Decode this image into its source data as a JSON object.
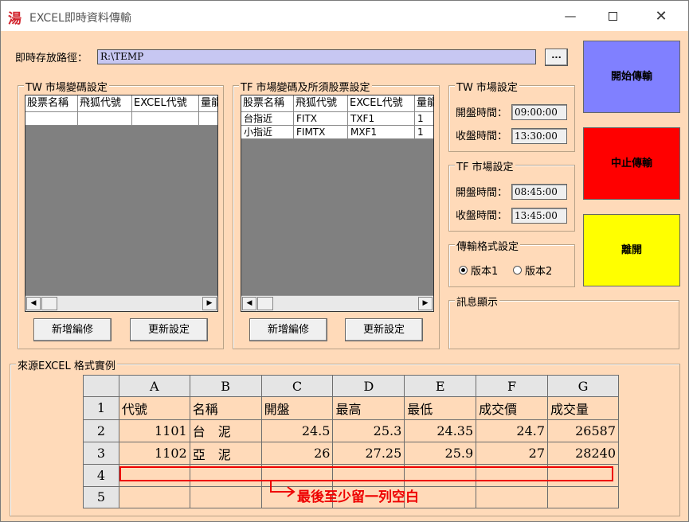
{
  "window": {
    "title": "EXCEL即時資料傳輸",
    "icon_glyph": "湯"
  },
  "path": {
    "label": "即時存放路徑：",
    "value": "R:\\TEMP",
    "browse_label": "..."
  },
  "tw_grid": {
    "legend": "TW 市場變碼設定",
    "headers": [
      "股票名稱",
      "飛狐代號",
      "EXCEL代號",
      "量能"
    ],
    "rows": [
      [
        "",
        "",
        "",
        ""
      ]
    ],
    "add_label": "新增編修",
    "update_label": "更新設定"
  },
  "tf_grid": {
    "legend": "TF 市場變碼及所須股票設定",
    "headers": [
      "股票名稱",
      "飛狐代號",
      "EXCEL代號",
      "量能"
    ],
    "rows": [
      [
        "台指近",
        "FITX",
        "TXF1",
        "1"
      ],
      [
        "小指近",
        "FIMTX",
        "MXF1",
        "1"
      ]
    ],
    "add_label": "新增編修",
    "update_label": "更新設定"
  },
  "tw_market": {
    "legend": "TW 市場設定",
    "open_label": "開盤時間：",
    "open_value": "09:00:00",
    "close_label": "收盤時間：",
    "close_value": "13:30:00"
  },
  "tf_market": {
    "legend": "TF 市場設定",
    "open_label": "開盤時間：",
    "open_value": "08:45:00",
    "close_label": "收盤時間：",
    "close_value": "13:45:00"
  },
  "format": {
    "legend": "傳輸格式設定",
    "option1": "版本1",
    "option2": "版本2",
    "selected": "版本1"
  },
  "message": {
    "legend": "訊息顯示"
  },
  "actions": {
    "start_label": "開始傳輸",
    "start_color": "#8080ff",
    "stop_label": "中止傳輸",
    "stop_color": "#ff0000",
    "exit_label": "離開",
    "exit_color": "#ffff00"
  },
  "excel": {
    "legend": "來源EXCEL 格式實例",
    "columns": [
      "A",
      "B",
      "C",
      "D",
      "E",
      "F",
      "G"
    ],
    "row_numbers": [
      "1",
      "2",
      "3",
      "4",
      "5"
    ],
    "rows": [
      [
        "代號",
        "名稱",
        "開盤",
        "最高",
        "最低",
        "成交價",
        "成交量"
      ],
      [
        "1101",
        "台　泥",
        "24.5",
        "25.3",
        "24.35",
        "24.7",
        "26587"
      ],
      [
        "1102",
        "亞　泥",
        "26",
        "27.25",
        "25.9",
        "27",
        "28240"
      ],
      [
        "",
        "",
        "",
        "",
        "",
        "",
        ""
      ],
      [
        "",
        "",
        "",
        "",
        "",
        "",
        ""
      ]
    ],
    "note": "最後至少留一列空白"
  }
}
